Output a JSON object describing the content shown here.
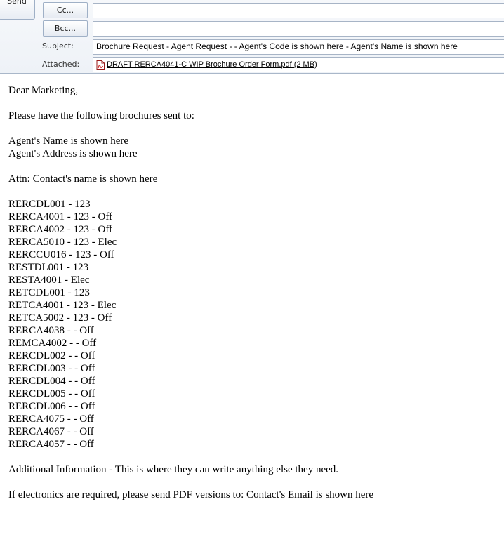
{
  "header": {
    "send_label": "Send",
    "cc_label": "Cc...",
    "bcc_label": "Bcc...",
    "cc_value": "",
    "bcc_value": "",
    "subject_label": "Subject:",
    "subject_value": "Brochure Request - Agent Request -  - Agent's Code is shown here - Agent's Name is shown here",
    "attached_label": "Attached:",
    "attachment": "DRAFT RERCA4041-C WIP Brochure Order Form.pdf (2 MB)",
    "attachment_icon": "pdf-icon"
  },
  "body": {
    "greeting": "Dear Marketing,",
    "intro": "Please have the following brochures sent to:",
    "agent_name": "Agent's Name is shown here",
    "agent_address": "Agent's Address is shown here",
    "attn": "Attn: Contact's name is shown here",
    "items": [
      "RERCDL001 - 123",
      "RERCA4001 - 123 - Off",
      "RERCA4002 - 123 - Off",
      "RERCA5010 - 123 - Elec",
      "RERCCU016 - 123 - Off",
      "RESTDL001 - 123",
      "RESTA4001 - Elec",
      "RETCDL001 - 123",
      "RETCA4001 - 123 - Elec",
      "RETCA5002 - 123 - Off",
      "RERCA4038 -  - Off",
      "REMCA4002 -  - Off",
      "RERCDL002 -  - Off",
      "RERCDL003 -  - Off",
      "RERCDL004 -  - Off",
      "RERCDL005 -  - Off",
      "RERCDL006 -  - Off",
      "RERCA4075 -  - Off",
      "RERCA4067 -  - Off",
      "RERCA4057 -  - Off"
    ],
    "additional": "Additional Information - This is where they can write anything else they need.",
    "closing": "If electronics are required, please send PDF versions to: Contact's Email is shown here"
  }
}
